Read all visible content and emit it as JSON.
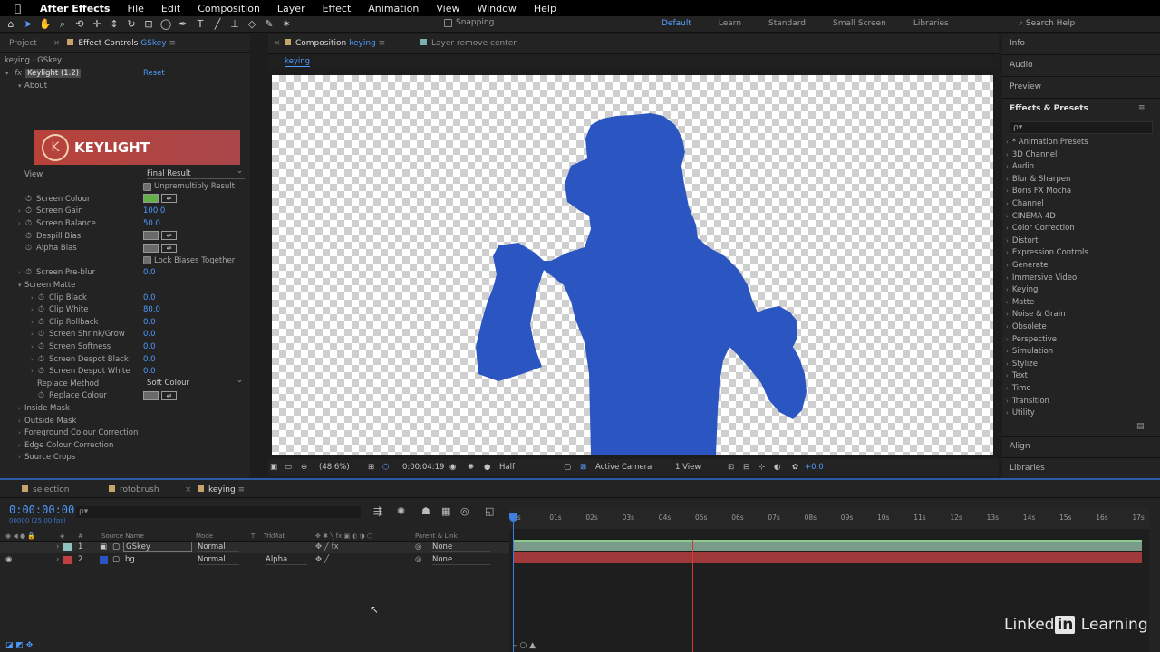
{
  "menubar": {
    "app": "After Effects",
    "items": [
      "File",
      "Edit",
      "Composition",
      "Layer",
      "Effect",
      "Animation",
      "View",
      "Window",
      "Help"
    ]
  },
  "toolbar": {
    "snapping_label": "Snapping",
    "workspaces": [
      "Default",
      "Learn",
      "Standard",
      "Small Screen",
      "Libraries"
    ],
    "current_workspace": "Default",
    "search_help": "Search Help"
  },
  "left_panel": {
    "tab_project": "Project",
    "tab_effect_controls": "Effect Controls",
    "tab_effect_controls_layer": "GSkey",
    "breadcrumb": "keying · GSkey",
    "effect_name": "Keylight (1.2)",
    "reset_label": "Reset",
    "about_label": "About",
    "logo_text": "KEYLIGHT",
    "rows": [
      {
        "label": "View",
        "value": "Final Result",
        "kind": "dropdown"
      },
      {
        "label": "Unpremultiply Result",
        "kind": "checkbox"
      },
      {
        "label": "Screen Colour",
        "kind": "color-green"
      },
      {
        "label": "Screen Gain",
        "value": "100.0",
        "kind": "number"
      },
      {
        "label": "Screen Balance",
        "value": "50.0",
        "kind": "number"
      },
      {
        "label": "Despill Bias",
        "kind": "color-grey"
      },
      {
        "label": "Alpha Bias",
        "kind": "color-grey"
      },
      {
        "label": "Lock Biases Together",
        "kind": "checkbox"
      },
      {
        "label": "Screen Pre-blur",
        "value": "0.0",
        "kind": "number"
      },
      {
        "label": "Screen Matte",
        "kind": "group"
      },
      {
        "label": "Clip Black",
        "value": "0.0",
        "kind": "number"
      },
      {
        "label": "Clip White",
        "value": "80.0",
        "kind": "number"
      },
      {
        "label": "Clip Rollback",
        "value": "0.0",
        "kind": "number"
      },
      {
        "label": "Screen Shrink/Grow",
        "value": "0.0",
        "kind": "number"
      },
      {
        "label": "Screen Softness",
        "value": "0.0",
        "kind": "number"
      },
      {
        "label": "Screen Despot Black",
        "value": "0.0",
        "kind": "number"
      },
      {
        "label": "Screen Despot White",
        "value": "0.0",
        "kind": "number"
      },
      {
        "label": "Replace Method",
        "value": "Soft Colour",
        "kind": "dropdown"
      },
      {
        "label": "Replace Colour",
        "kind": "color-grey"
      },
      {
        "label": "Inside Mask",
        "kind": "group"
      },
      {
        "label": "Outside Mask",
        "kind": "group"
      },
      {
        "label": "Foreground Colour Correction",
        "kind": "group"
      },
      {
        "label": "Edge Colour Correction",
        "kind": "group"
      },
      {
        "label": "Source Crops",
        "kind": "group"
      }
    ]
  },
  "viewer": {
    "tab_composition": "Composition",
    "tab_composition_name": "keying",
    "tab_layer": "Layer remove center",
    "sub_tab": "keying",
    "zoom": "(48.6%)",
    "timecode": "0:00:04:19",
    "resolution": "Half",
    "camera": "Active Camera",
    "views": "1 View",
    "exposure": "+0.0",
    "silhouette_color": "#2b55c0"
  },
  "right_panel": {
    "sections": [
      "Info",
      "Audio",
      "Preview"
    ],
    "effects_title": "Effects & Presets",
    "search_placeholder": "ρ▾",
    "categories": [
      "* Animation Presets",
      "3D Channel",
      "Audio",
      "Blur & Sharpen",
      "Boris FX Mocha",
      "Channel",
      "CINEMA 4D",
      "Color Correction",
      "Distort",
      "Expression Controls",
      "Generate",
      "Immersive Video",
      "Keying",
      "Matte",
      "Noise & Grain",
      "Obsolete",
      "Perspective",
      "Simulation",
      "Stylize",
      "Text",
      "Time",
      "Transition",
      "Utility"
    ],
    "align_label": "Align",
    "libraries_label": "Libraries"
  },
  "timeline": {
    "tabs": [
      "selection",
      "rotobrush",
      "keying"
    ],
    "active_tab": "keying",
    "timecode": "0:00:00:00",
    "fps": "00000 (25.00 fps)",
    "search_placeholder": "ρ▾",
    "columns": [
      "#",
      "Source Name",
      "Mode",
      "T",
      "TrkMat",
      "Parent & Link"
    ],
    "layers": [
      {
        "num": "1",
        "name": "GSkey",
        "mode": "Normal",
        "trkmat": "",
        "parent": "None",
        "color": "#8fc3c0"
      },
      {
        "num": "2",
        "name": "bg",
        "mode": "Normal",
        "trkmat": "Alpha",
        "parent": "None",
        "color": "#c04040"
      }
    ],
    "ruler": [
      "0s",
      "01s",
      "02s",
      "03s",
      "04s",
      "05s",
      "06s",
      "07s",
      "08s",
      "09s",
      "10s",
      "11s",
      "12s",
      "13s",
      "14s",
      "15s",
      "16s",
      "17s"
    ]
  },
  "watermark": {
    "text_pre": "Linked",
    "text_in": "in",
    "text_post": " Learning"
  }
}
